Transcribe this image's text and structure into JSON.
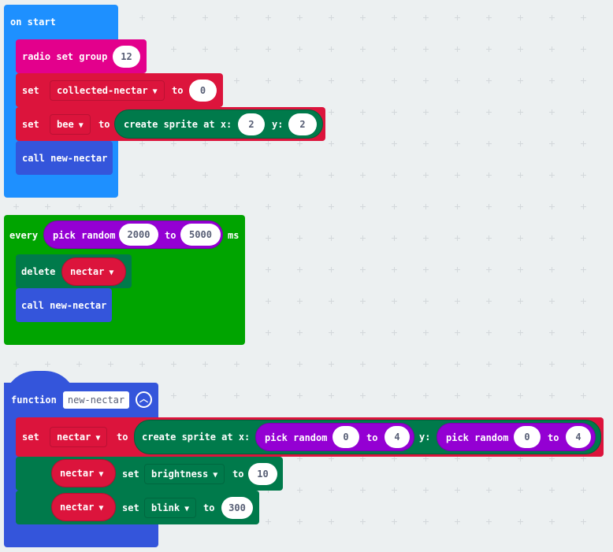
{
  "colors": {
    "events": "#1e90ff",
    "radio": "#e3008c",
    "variables": "#dc143c",
    "sprites": "#007a4b",
    "functions": "#3455db",
    "loops": "#00a400",
    "math": "#9400d3",
    "workspace": "#ecf0f1"
  },
  "on_start": {
    "label": "on start",
    "radio": {
      "label": "radio set group",
      "value": "12"
    },
    "set1": {
      "set": "set",
      "variable": "collected-nectar",
      "to": "to",
      "value": "0"
    },
    "set2": {
      "set": "set",
      "variable": "bee",
      "to": "to",
      "create": "create sprite at x:",
      "x": "2",
      "y_label": "y:",
      "y": "2"
    },
    "call": "call new-nectar"
  },
  "every": {
    "label": "every",
    "pick": "pick random",
    "from": "2000",
    "to": "to",
    "max": "5000",
    "unit": "ms",
    "delete": {
      "label": "delete",
      "variable": "nectar"
    },
    "call": "call new-nectar"
  },
  "function": {
    "label": "function",
    "name": "new-nectar",
    "set": {
      "set": "set",
      "variable": "nectar",
      "to": "to",
      "create": "create sprite at x:",
      "pick1": "pick random",
      "x_min": "0",
      "to1": "to",
      "x_max": "4",
      "y_label": "y:",
      "pick2": "pick random",
      "y_min": "0",
      "to2": "to",
      "y_max": "4"
    },
    "bright": {
      "variable": "nectar",
      "set": "set",
      "property": "brightness",
      "to": "to",
      "value": "10"
    },
    "blink": {
      "variable": "nectar",
      "set": "set",
      "property": "blink",
      "to": "to",
      "value": "300"
    }
  }
}
